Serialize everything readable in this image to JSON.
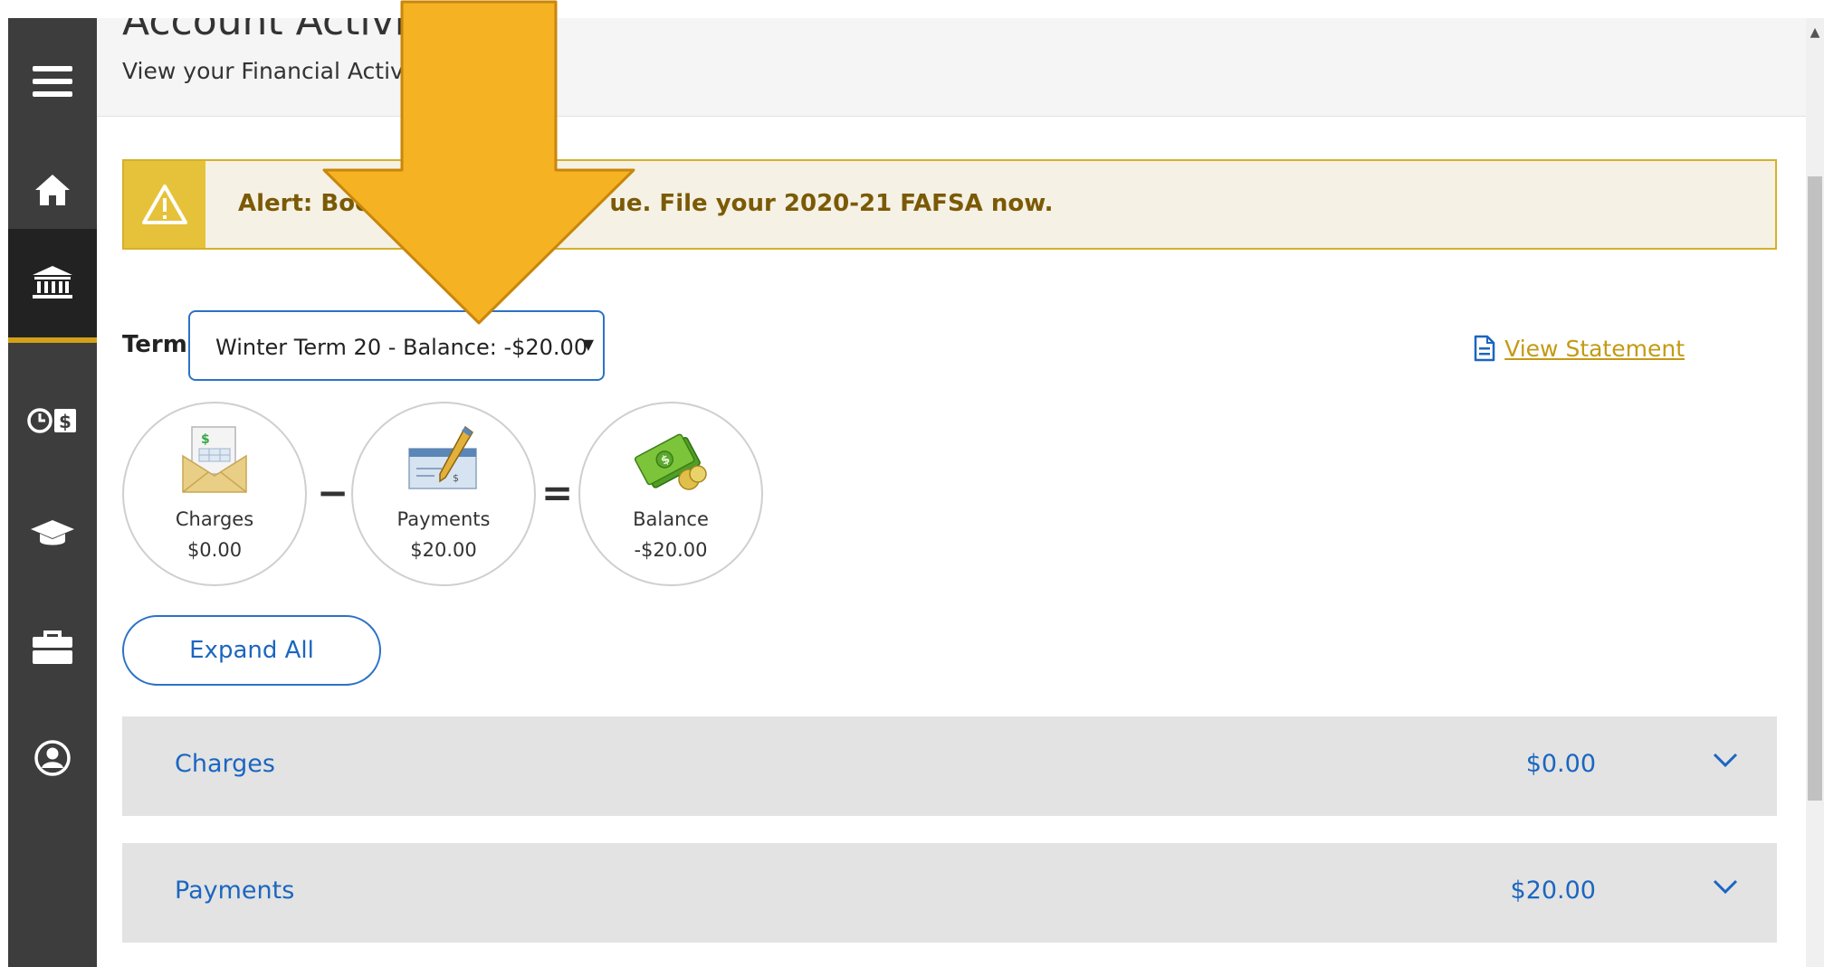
{
  "header": {
    "title": "Account Activity",
    "subtitle": "View your Financial Activity"
  },
  "sidebar": {
    "items": [
      {
        "icon": "menu-icon"
      },
      {
        "icon": "home-icon"
      },
      {
        "icon": "bank-icon",
        "active": true
      },
      {
        "icon": "payment-plan-icon"
      },
      {
        "icon": "graduation-cap-icon"
      },
      {
        "icon": "briefcase-icon"
      },
      {
        "icon": "user-icon"
      }
    ]
  },
  "alert": {
    "label": "Alert:",
    "text_visible_start": "Book",
    "text_visible_end": "ue. File your 2020-21 FAFSA now."
  },
  "term": {
    "label": "Term",
    "selected": "Winter Term 20 - Balance: -$20.00"
  },
  "view_statement": {
    "label": "View Statement"
  },
  "summary": {
    "charges": {
      "label": "Charges",
      "value": "$0.00"
    },
    "minus": "−",
    "payments": {
      "label": "Payments",
      "value": "$20.00"
    },
    "equals": "=",
    "balance": {
      "label": "Balance",
      "value": "-$20.00"
    }
  },
  "expand_all": {
    "label": "Expand All"
  },
  "accordion": [
    {
      "label": "Charges",
      "amount": "$0.00"
    },
    {
      "label": "Payments",
      "amount": "$20.00"
    }
  ],
  "colors": {
    "sidebar_bg": "#3d3d3d",
    "active_accent": "#d4a017",
    "link_blue": "#1b66c0",
    "arrow_fill": "#f5b324",
    "alert_bg": "#f5f1e5",
    "alert_text": "#7b5a06"
  }
}
